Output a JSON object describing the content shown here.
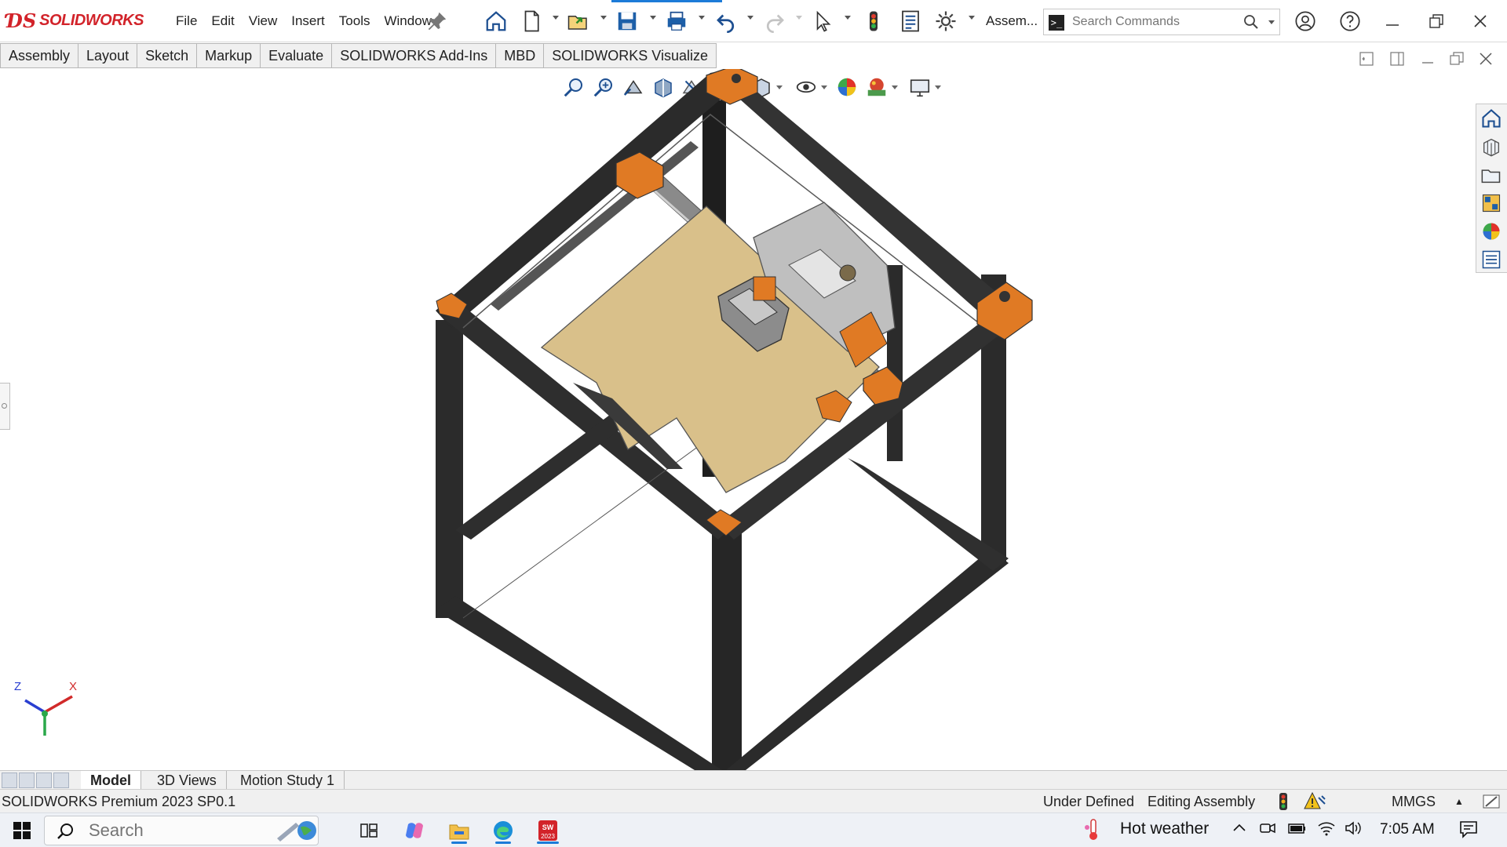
{
  "app": {
    "logo_mark": "ƊS",
    "logo_text": "SOLIDWORKS",
    "menu": [
      "File",
      "Edit",
      "View",
      "Insert",
      "Tools",
      "Window"
    ],
    "doc_label": "Assem...",
    "search_placeholder": "Search Commands"
  },
  "command_tabs": [
    "Assembly",
    "Layout",
    "Sketch",
    "Markup",
    "Evaluate",
    "SOLIDWORKS Add-Ins",
    "MBD",
    "SOLIDWORKS Visualize"
  ],
  "triad": {
    "z": "Z",
    "x": "X"
  },
  "bottom_tabs": [
    "Model",
    "3D Views",
    "Motion Study 1"
  ],
  "status": {
    "product": "SOLIDWORKS Premium 2023 SP0.1",
    "state": "Under Defined",
    "mode": "Editing Assembly",
    "units": "MMGS"
  },
  "taskbar": {
    "search_placeholder": "Search",
    "weather": "Hot weather",
    "time": "7:05 AM",
    "sw_badge": "2023"
  },
  "colors": {
    "brand_red": "#d2232a",
    "frame": "#2b2b2b",
    "bracket": "#e07a24",
    "bed": "#d9c08a",
    "accent_blue": "#1c7bd8"
  }
}
